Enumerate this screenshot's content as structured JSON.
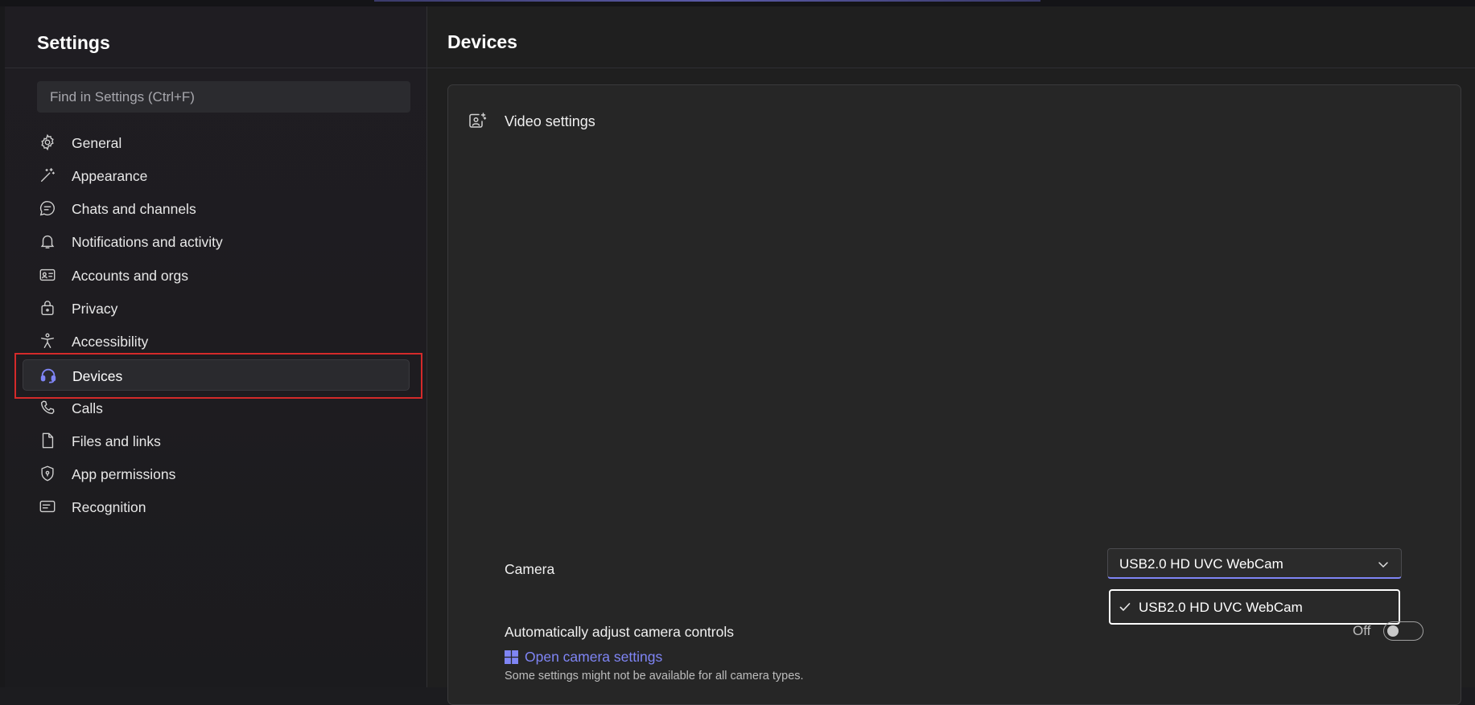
{
  "sidebar": {
    "title": "Settings",
    "search_placeholder": "Find in Settings (Ctrl+F)",
    "items": [
      {
        "label": "General",
        "icon": "gear-icon"
      },
      {
        "label": "Appearance",
        "icon": "magic-wand-icon"
      },
      {
        "label": "Chats and channels",
        "icon": "chat-icon"
      },
      {
        "label": "Notifications and activity",
        "icon": "bell-icon"
      },
      {
        "label": "Accounts and orgs",
        "icon": "id-card-icon"
      },
      {
        "label": "Privacy",
        "icon": "lock-icon"
      },
      {
        "label": "Accessibility",
        "icon": "accessibility-icon"
      },
      {
        "label": "Devices",
        "icon": "headset-icon",
        "active": true
      },
      {
        "label": "Calls",
        "icon": "phone-icon"
      },
      {
        "label": "Files and links",
        "icon": "file-icon"
      },
      {
        "label": "App permissions",
        "icon": "shield-icon"
      },
      {
        "label": "Recognition",
        "icon": "captions-icon"
      }
    ]
  },
  "main": {
    "title": "Devices",
    "video_section": {
      "title": "Video settings",
      "camera_label": "Camera",
      "camera_selected": "USB2.0 HD UVC WebCam",
      "camera_options": [
        "USB2.0 HD UVC WebCam"
      ],
      "auto_adjust_label": "Automatically adjust camera controls",
      "auto_adjust_state": "Off",
      "open_camera_settings": "Open camera settings",
      "note": "Some settings might not be available for all camera types."
    }
  },
  "colors": {
    "accent": "#7f85f5",
    "highlight_box": "#d42a2a",
    "background": "#1f1f1f"
  }
}
